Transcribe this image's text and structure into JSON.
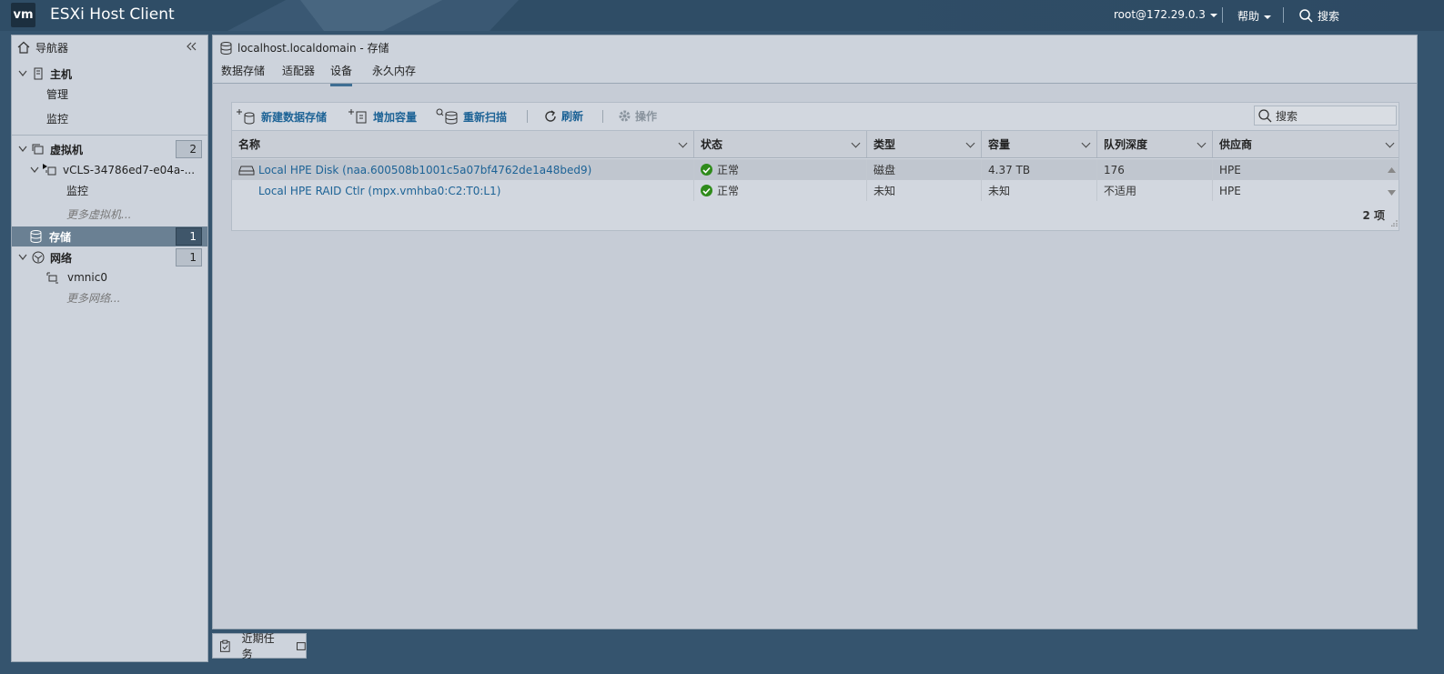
{
  "header": {
    "logo_text": "vm",
    "app_title": "ESXi Host Client",
    "user": "root@172.29.0.3",
    "help": "帮助",
    "search": "搜索"
  },
  "navigator": {
    "title": "导航器",
    "host": {
      "label": "主机",
      "children": [
        "管理",
        "监控"
      ]
    },
    "vms": {
      "label": "虚拟机",
      "count": "2",
      "vm_name": "vCLS-34786ed7-e04a-...",
      "vm_child": "监控",
      "more": "更多虚拟机..."
    },
    "storage": {
      "label": "存储",
      "count": "1"
    },
    "network": {
      "label": "网络",
      "count": "1",
      "nic": "vmnic0",
      "more": "更多网络..."
    }
  },
  "main": {
    "title": "localhost.localdomain - 存储",
    "tabs": [
      "数据存储",
      "适配器",
      "设备",
      "永久内存"
    ],
    "active_tab": "设备"
  },
  "toolbar": {
    "new_datastore": "新建数据存储",
    "increase_capacity": "增加容量",
    "rescan": "重新扫描",
    "refresh": "刷新",
    "actions": "操作",
    "search_placeholder": "搜索"
  },
  "table": {
    "columns": [
      "名称",
      "状态",
      "类型",
      "容量",
      "队列深度",
      "供应商"
    ],
    "rows": [
      {
        "name": "Local HPE Disk (naa.600508b1001c5a07bf4762de1a48bed9)",
        "status": "正常",
        "type": "磁盘",
        "capacity": "4.37 TB",
        "queue_depth": "176",
        "vendor": "HPE"
      },
      {
        "name": "Local HPE RAID Ctlr (mpx.vmhba0:C2:T0:L1)",
        "status": "正常",
        "type": "未知",
        "capacity": "未知",
        "queue_depth": "不适用",
        "vendor": "HPE"
      }
    ],
    "count": "2 项"
  },
  "bottom": {
    "recent_tasks": "近期任务"
  },
  "colors": {
    "accent": "#1d6396",
    "ok": "#2f8b1b",
    "selected_nav": "#6a8093"
  }
}
